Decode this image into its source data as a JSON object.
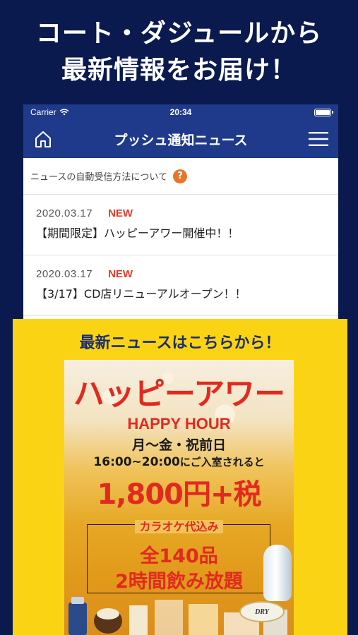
{
  "headline": {
    "line1": "コート・ダジュールから",
    "line2": "最新情報をお届け！"
  },
  "status_bar": {
    "carrier": "Carrier",
    "time": "20:34",
    "icons": [
      "wifi-icon",
      "battery-icon"
    ]
  },
  "nav": {
    "title": "プッシュ通知ニュース",
    "left_icon": "home-icon",
    "right_icon": "hamburger-menu-icon"
  },
  "info_row": {
    "text": "ニュースの自動受信方法について",
    "help_symbol": "?"
  },
  "news": [
    {
      "date": "2020.03.17",
      "badge": "NEW",
      "title": "【期間限定】ハッピーアワー開催中！！"
    },
    {
      "date": "2020.03.17",
      "badge": "NEW",
      "title": "【3/17】CD店リニューアルオープン！！"
    }
  ],
  "promo": {
    "caption": "最新ニュースはこちらから！",
    "poster": {
      "title": "ハッピーアワー",
      "subtitle": "HAPPY HOUR",
      "days": "月～金・祝前日",
      "time_range": "16:00~20:00",
      "time_suffix": "にご入室されると",
      "price": "1,800円+税",
      "karaoke": "カラオケ代込み",
      "count": "全140品",
      "nomihoudai": "2時間飲み放題",
      "brand": "DRY"
    }
  },
  "colors": {
    "background": "#0b1a4e",
    "nav_bar": "#1f3a8a",
    "promo_yellow": "#fad414",
    "badge_red": "#e23b2a",
    "help_orange": "#e8752c"
  }
}
